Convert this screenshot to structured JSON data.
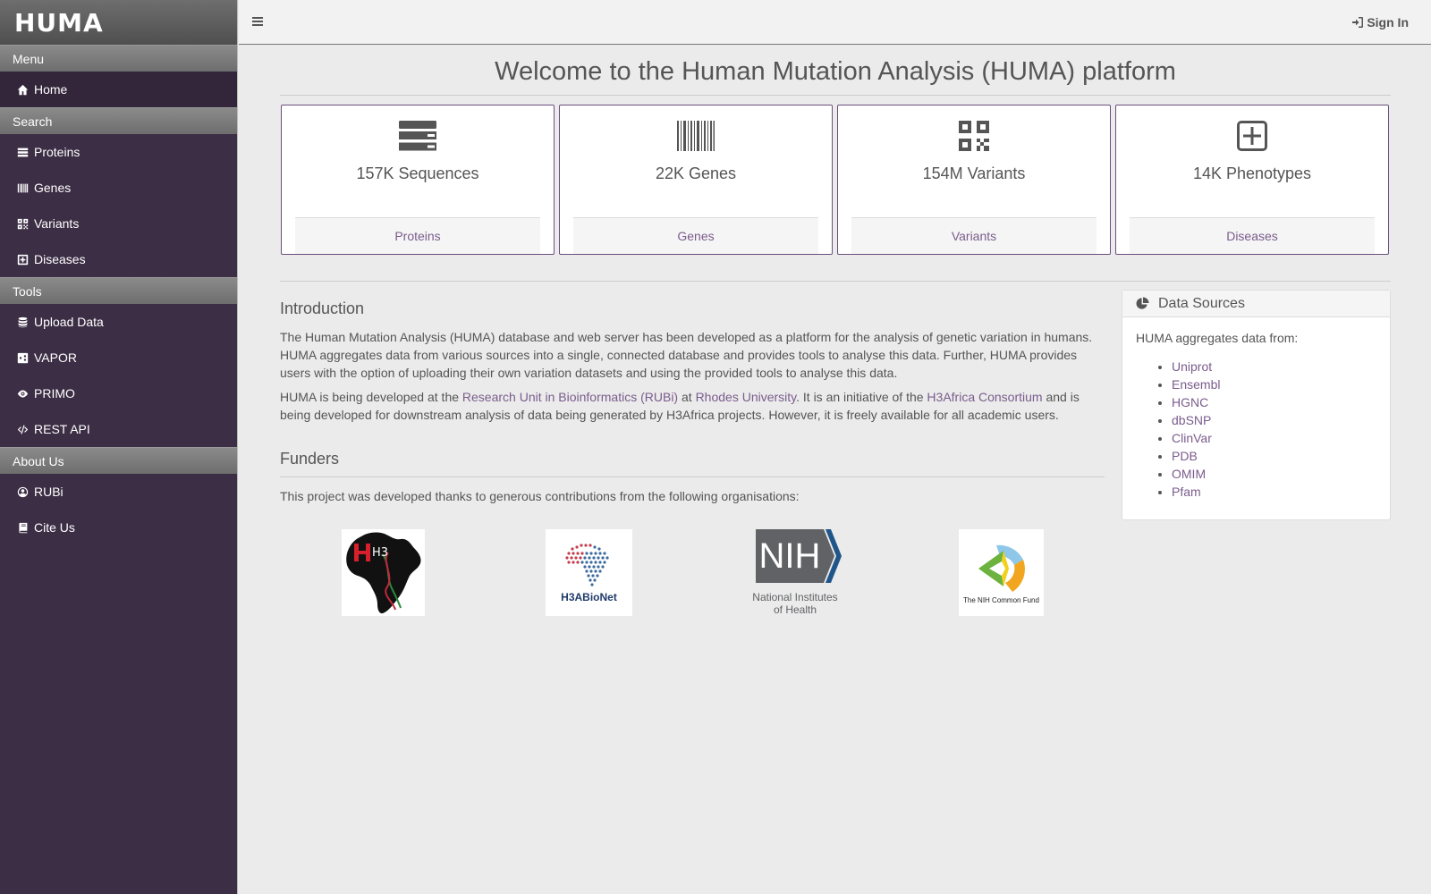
{
  "brand": "HUMA",
  "sidebar": {
    "sections": [
      {
        "title": "Menu",
        "items": [
          {
            "label": "Home",
            "icon": "home-icon",
            "active": true
          }
        ]
      },
      {
        "title": "Search",
        "items": [
          {
            "label": "Proteins",
            "icon": "server-icon"
          },
          {
            "label": "Genes",
            "icon": "barcode-icon"
          },
          {
            "label": "Variants",
            "icon": "qrcode-icon"
          },
          {
            "label": "Diseases",
            "icon": "plus-square-icon"
          }
        ]
      },
      {
        "title": "Tools",
        "items": [
          {
            "label": "Upload Data",
            "icon": "database-icon"
          },
          {
            "label": "VAPOR",
            "icon": "share-icon"
          },
          {
            "label": "PRIMO",
            "icon": "eye-icon"
          },
          {
            "label": "REST API",
            "icon": "code-icon"
          }
        ]
      },
      {
        "title": "About Us",
        "items": [
          {
            "label": "RUBi",
            "icon": "user-circle-icon"
          },
          {
            "label": "Cite Us",
            "icon": "book-icon"
          }
        ]
      }
    ]
  },
  "topbar": {
    "signin": "Sign In"
  },
  "main": {
    "welcome": "Welcome to the Human Mutation Analysis (HUMA) platform",
    "cards": [
      {
        "count": "157K Sequences",
        "link": "Proteins",
        "icon": "server-icon"
      },
      {
        "count": "22K Genes",
        "link": "Genes",
        "icon": "barcode-icon"
      },
      {
        "count": "154M Variants",
        "link": "Variants",
        "icon": "qrcode-icon"
      },
      {
        "count": "14K Phenotypes",
        "link": "Diseases",
        "icon": "plus-square-icon"
      }
    ],
    "intro": {
      "title": "Introduction",
      "p1": "The Human Mutation Analysis (HUMA) database and web server has been developed as a platform for the analysis of genetic variation in humans. HUMA aggregates data from various sources into a single, connected database and provides tools to analyse this data. Further, HUMA provides users with the option of uploading their own variation datasets and using the provided tools to analyse this data.",
      "p2_a": "HUMA is being developed at the ",
      "p2_link1": "Research Unit in Bioinformatics (RUBi)",
      "p2_b": " at ",
      "p2_link2": "Rhodes University",
      "p2_c": ". It is an initiative of the ",
      "p2_link3": "H3Africa Consortium",
      "p2_d": " and is being developed for downstream analysis of data being generated by H3Africa projects. However, it is freely available for all academic users."
    },
    "funders": {
      "title": "Funders",
      "text": "This project was developed thanks to generous contributions from the following organisations:",
      "logos": {
        "h3africa": "H3",
        "h3abionet": "H3ABioNet",
        "nih_mark": "NIH",
        "nih_line1": "National Institutes",
        "nih_line2": "of Health",
        "commonfund": "The NIH Common Fund"
      }
    },
    "data_sources": {
      "title": "Data Sources",
      "intro": "HUMA aggregates data from:",
      "items": [
        "Uniprot",
        "Ensembl",
        "HGNC",
        "dbSNP",
        "ClinVar",
        "PDB",
        "OMIM",
        "Pfam"
      ]
    }
  }
}
